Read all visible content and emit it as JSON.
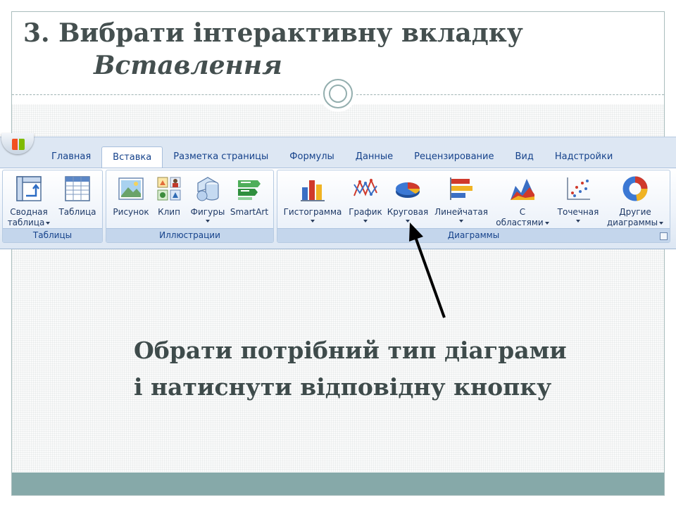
{
  "slide": {
    "title_line1": "3. Вибрати інтерактивну вкладку",
    "title_line2": "Вставлення",
    "instruction_line1": "Обрати потрібний тип діаграми",
    "instruction_line2": "і натиснути відповідну кнопку"
  },
  "ribbon": {
    "tabs": [
      "Главная",
      "Вставка",
      "Разметка страницы",
      "Формулы",
      "Данные",
      "Рецензирование",
      "Вид",
      "Надстройки"
    ],
    "active_tab": "Вставка",
    "groups": {
      "tables": {
        "label": "Таблицы",
        "pivot_table_line1": "Сводная",
        "pivot_table_line2": "таблица",
        "table": "Таблица"
      },
      "illustrations": {
        "label": "Иллюстрации",
        "picture": "Рисунок",
        "clip": "Клип",
        "shapes": "Фигуры",
        "smartart": "SmartArt"
      },
      "charts": {
        "label": "Диаграммы",
        "column": "Гистограмма",
        "line": "График",
        "pie": "Круговая",
        "bar": "Линейчатая",
        "area_line1": "С",
        "area_line2": "областями",
        "scatter": "Точечная",
        "other_line1": "Другие",
        "other_line2": "диаграммы"
      }
    }
  },
  "colors": {
    "title": "#444f4f",
    "footer_band": "#86a9a9",
    "ribbon_text": "#15428b",
    "arrow": "#000000"
  }
}
